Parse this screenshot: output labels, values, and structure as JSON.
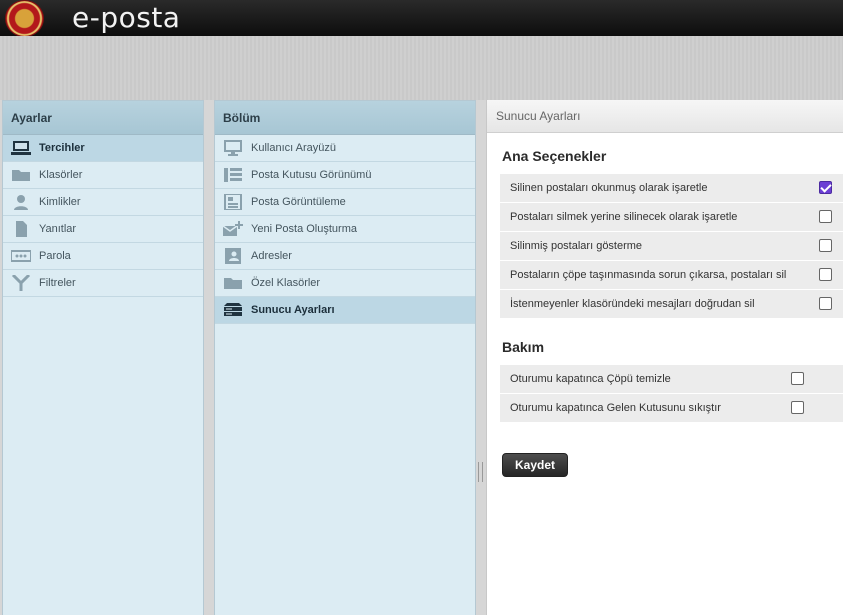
{
  "app": {
    "title": "e-posta"
  },
  "settings_panel": {
    "header": "Ayarlar",
    "items": [
      {
        "label": "Tercihler",
        "icon": "monitor-icon"
      },
      {
        "label": "Klasörler",
        "icon": "folder-icon"
      },
      {
        "label": "Kimlikler",
        "icon": "person-icon"
      },
      {
        "label": "Yanıtlar",
        "icon": "document-icon"
      },
      {
        "label": "Parola",
        "icon": "password-icon"
      },
      {
        "label": "Filtreler",
        "icon": "filter-icon"
      }
    ]
  },
  "section_panel": {
    "header": "Bölüm",
    "items": [
      {
        "label": "Kullanıcı Arayüzü",
        "icon": "monitor-icon"
      },
      {
        "label": "Posta Kutusu Görünümü",
        "icon": "list-view-icon"
      },
      {
        "label": "Posta Görüntüleme",
        "icon": "message-view-icon"
      },
      {
        "label": "Yeni Posta Oluşturma",
        "icon": "compose-icon"
      },
      {
        "label": "Adresler",
        "icon": "address-book-icon"
      },
      {
        "label": "Özel Klasörler",
        "icon": "folder-icon"
      },
      {
        "label": "Sunucu Ayarları",
        "icon": "server-icon"
      }
    ]
  },
  "server_settings": {
    "header": "Sunucu Ayarları",
    "main_title": "Ana Seçenekler",
    "main_options": [
      {
        "label": "Silinen postaları okunmuş olarak işaretle",
        "checked": true
      },
      {
        "label": "Postaları silmek yerine silinecek olarak işaretle",
        "checked": false
      },
      {
        "label": "Silinmiş postaları gösterme",
        "checked": false
      },
      {
        "label": "Postaların çöpe taşınmasında sorun çıkarsa, postaları sil",
        "checked": false
      },
      {
        "label": "İstenmeyenler klasöründeki mesajları doğrudan sil",
        "checked": false
      }
    ],
    "maintenance_title": "Bakım",
    "maintenance_options": [
      {
        "label": "Oturumu kapatınca Çöpü temizle",
        "checked": false
      },
      {
        "label": "Oturumu kapatınca Gelen Kutusunu sıkıştır",
        "checked": false
      }
    ],
    "save_label": "Kaydet"
  },
  "colors": {
    "accent": "#6b3fd4",
    "panel_bg": "#dcecf3",
    "header_bg": "#a7c6d4"
  }
}
